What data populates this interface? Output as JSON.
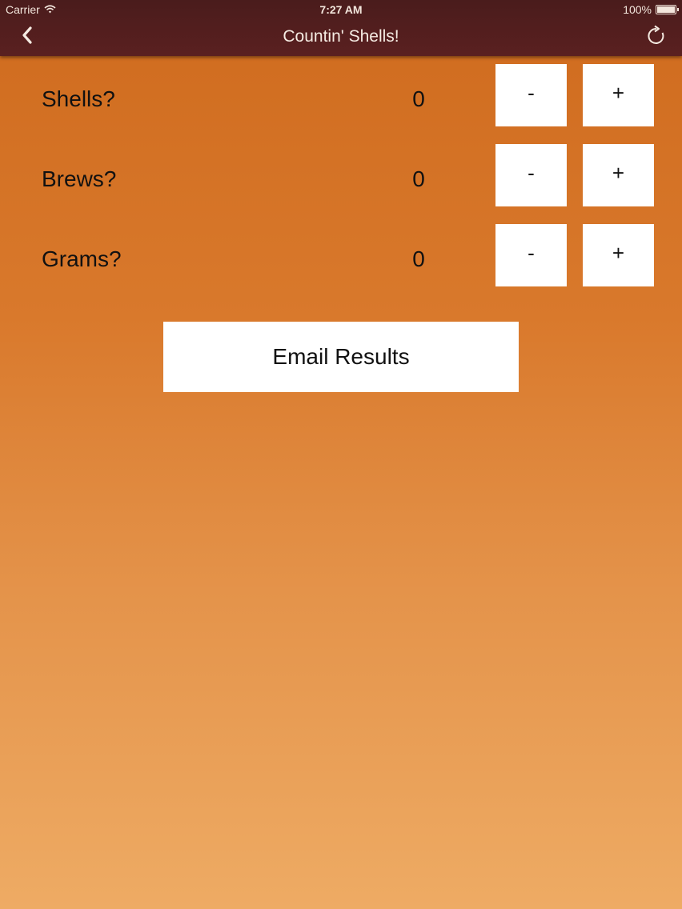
{
  "status_bar": {
    "carrier": "Carrier",
    "time": "7:27 AM",
    "battery": "100%"
  },
  "nav": {
    "title": "Countin' Shells!",
    "back_icon": "chevron-left-icon",
    "refresh_icon": "refresh-icon"
  },
  "counters": [
    {
      "label": "Shells?",
      "value": "0",
      "minus": "-",
      "plus": "+"
    },
    {
      "label": "Brews?",
      "value": "0",
      "minus": "-",
      "plus": "+"
    },
    {
      "label": "Grams?",
      "value": "0",
      "minus": "-",
      "plus": "+"
    }
  ],
  "email_button": {
    "label": "Email Results"
  },
  "colors": {
    "nav_background": "#4e1e1e",
    "gradient_top": "#cf6b1e",
    "gradient_bottom": "#eeab64",
    "button_background": "#ffffff"
  }
}
